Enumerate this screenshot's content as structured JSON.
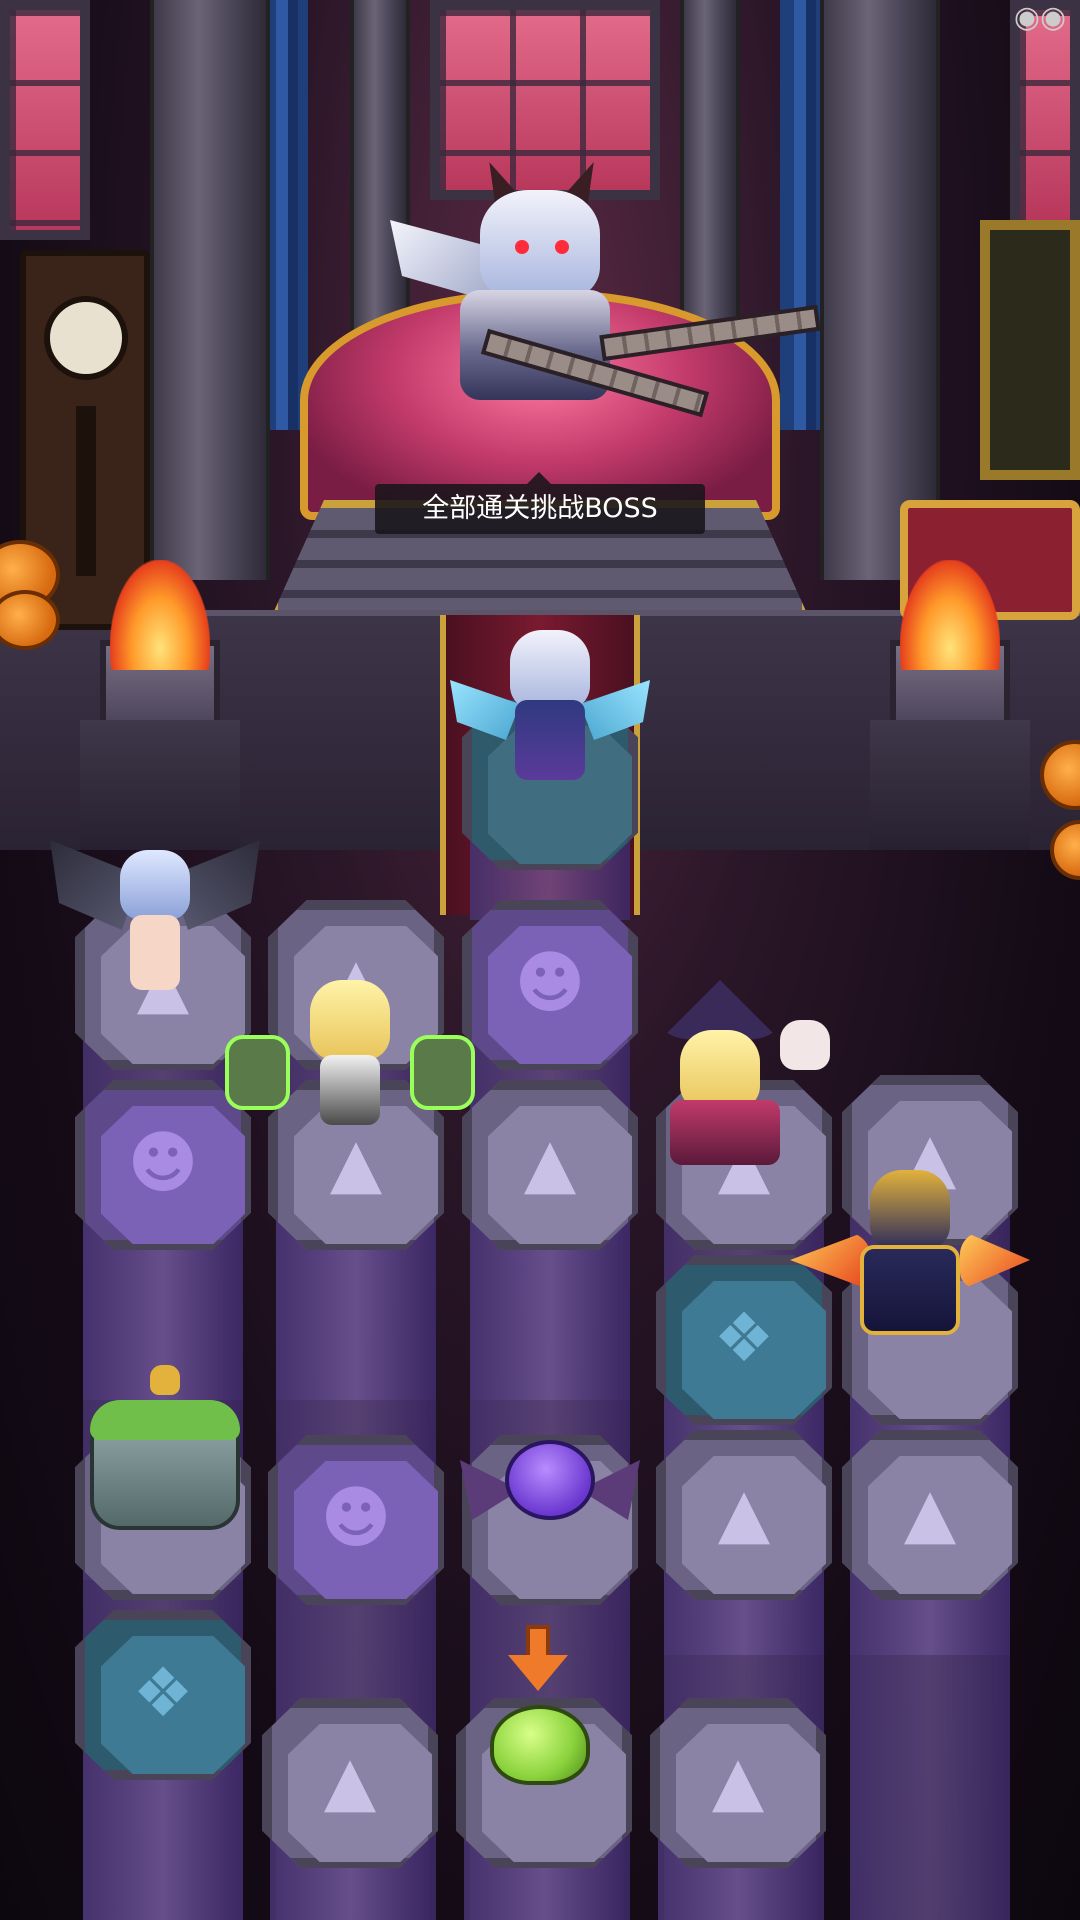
{
  "stage": {
    "boss_banner": "全部通关挑战BOSS"
  },
  "board": {
    "tiles": [
      {
        "type": "start",
        "icon": ""
      },
      {
        "type": "ghost",
        "icon": "ghost-icon"
      },
      {
        "type": "pumpkin",
        "icon": "pumpkin-icon"
      },
      {
        "type": "bat",
        "icon": "bat-icon"
      }
    ]
  },
  "colors": {
    "accent_gold": "#caa13a",
    "window_pink": "#e36b8a",
    "label_bg": "#18141a",
    "move_arrow": "#ef7a2a"
  }
}
